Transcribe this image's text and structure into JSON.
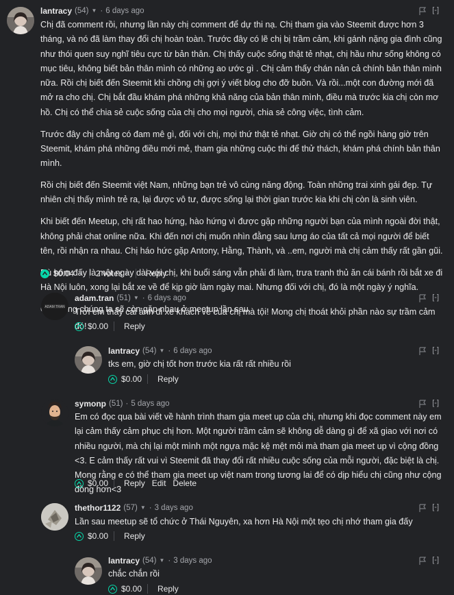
{
  "comments": [
    {
      "author": "lantracy",
      "rep": "(54)",
      "time": "6 days ago",
      "collapse": "[-]",
      "paragraphs": [
        "Chị đã comment rồi, nhưng lần này chị comment để dự thi nạ. Chị tham gia vào Steemit được hơn 3 tháng, và nó đã làm thay đổi chị hoàn toàn. Trước đây có lẽ chị bị trầm cảm, khi gánh nặng gia đình cũng như thói quen suy nghĩ tiêu cực từ bản thân. Chị thấy cuộc sống thật tẻ nhạt, chị hầu như sống không có mục tiêu, không biết bản thân mình có những ao ước gì . Chị cảm thấy chán nản cả chính bản thân mình nữa. Rồi chị biết đến Steemit khi chồng chị gợi ý viết blog cho đỡ buồn. Và rồi...một con đường mới đã mở ra cho chị. Chị bắt đầu khám phá những khả năng của bản thân mình, điều mà trước kia chị còn mơ hồ. Chị có thể chia sẻ cuộc sống của chị cho mọi người, chia sẻ công việc, tình cảm.",
        "Trước đây chị chẳng có đam mê gì, đối với chị, mọi thứ thật tẻ nhạt. Giờ chị có thể ngồi hàng giờ trên Steemit, khám phá những điều mới mẻ, tham gia những cuộc thi để thử thách, khám phá chính bản thân mình.",
        "Rồi chị biết đến Steemit việt Nam, những bạn trẻ vô cùng năng động. Toàn những trai xinh gái đẹp. Tự nhiên chị thấy mình trẻ ra, lại được vô tư, được sống lại thời gian trước kia khi chị còn là sinh viên.",
        "Khi biết đến Meetup, chị rất hao hứng, hào hứng vì được gặp những người bạn của mình ngoài đời thật, không phải chat online nữa. Khi đến nơi chị muốn nhìn đằng sau lưng áo của tất cả mọi người để biết tên, rồi nhận ra nhau. Chị háo hức gặp Antony, Hằng, Thành, và ..em, người mà chị cảm thấy rất gần gũi.",
        "Dù hôm đấy là một ngày dài với chị, khi buổi sáng vẫn phải đi làm, trưa tranh thủ ăn cái bánh rồi bắt xe đi Hà Nội luôn, xong lại bắt xe về để kịp giờ làm ngày mai. Nhưng đối với chị, đó là một ngày ý nghĩa.",
        "Chị mong chúng ta sẽ còn gặp nhau ở meetup lần sau."
      ],
      "payout": "$0.04",
      "votes": "2 votes",
      "reply": "Reply"
    },
    {
      "author": "adam.tran",
      "rep": "(51)",
      "time": "6 days ago",
      "collapse": "[-]",
      "avatar_text": "ADAM TRAN",
      "paragraphs": [
        "Trời em thấy cái ảnh đi xe khách về của chị mà tội! Mong chị thoát khỏi phần nào sự trầm cảm đó!"
      ],
      "payout": "$0.00",
      "reply": "Reply"
    },
    {
      "author": "lantracy",
      "rep": "(54)",
      "time": "6 days ago",
      "collapse": "[-]",
      "paragraphs": [
        "tks em, giờ chị tốt hơn trước kia rất rất nhiều rồi"
      ],
      "payout": "$0.00",
      "reply": "Reply"
    },
    {
      "author": "symonp",
      "rep": "(51)",
      "time": "5 days ago",
      "collapse": "[-]",
      "paragraphs": [
        "Em có đọc qua bài viết về hành trình tham gia meet up của chị, nhưng khi đọc comment này em lại cảm thấy cảm phục chị hơn. Một người trầm cảm sẽ không dễ dàng gì để xã giao với nơi có nhiều người, mà chị lại một mình một ngựa mặc kệ mệt mỏi mà tham gia meet up vì cộng đồng <3. E cảm thấy rất vui vì Steemit đã thay đổi rất nhiều cuộc sống của mỗi người, đặc biệt là chị. Mong rằng e có thể tham gia meet up việt nam trong tương lai để có dịp hiểu chị cũng như cộng đồng hơn<3"
      ],
      "payout": "$0.00",
      "reply": "Reply",
      "edit": "Edit",
      "delete": "Delete"
    },
    {
      "author": "thethor1122",
      "rep": "(57)",
      "time": "3 days ago",
      "collapse": "[-]",
      "paragraphs": [
        "Lần sau meetup sẽ tổ chức ở Thái Nguyên, xa hơn Hà Nội một tẹo chị nhớ tham gia đấy"
      ],
      "payout": "$0.00",
      "reply": "Reply"
    },
    {
      "author": "lantracy",
      "rep": "(54)",
      "time": "3 days ago",
      "collapse": "[-]",
      "paragraphs": [
        "chắc chắn rồi"
      ],
      "payout": "$0.00",
      "reply": "Reply"
    }
  ],
  "colors": {
    "background": "#222326",
    "text": "#e9e9ea",
    "muted": "#a4a6ab",
    "accent": "#07d7a9"
  }
}
